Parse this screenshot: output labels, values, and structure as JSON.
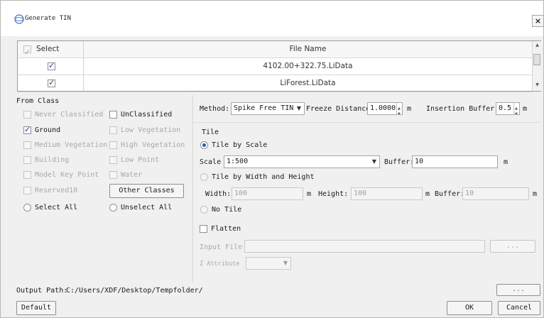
{
  "window": {
    "title": "Generate TIN",
    "close_label": "×"
  },
  "grid": {
    "header_select": "Select",
    "header_file": "File Name",
    "rows": [
      {
        "checked": true,
        "file": "4102.00+322.75.LiData"
      },
      {
        "checked": true,
        "file": "LiForest.LiData"
      }
    ]
  },
  "from_class": {
    "label": "From Class",
    "classes": [
      {
        "label": "Never Classified",
        "checked": false,
        "enabled": false
      },
      {
        "label": "UnClassified",
        "checked": false,
        "enabled": true
      },
      {
        "label": "Ground",
        "checked": true,
        "enabled": true
      },
      {
        "label": "Low Vegetation",
        "checked": false,
        "enabled": false
      },
      {
        "label": "Medium Vegetation",
        "checked": false,
        "enabled": false
      },
      {
        "label": "High Vegetation",
        "checked": false,
        "enabled": false
      },
      {
        "label": "Building",
        "checked": false,
        "enabled": false
      },
      {
        "label": "Low Point",
        "checked": false,
        "enabled": false
      },
      {
        "label": "Model Key Point",
        "checked": false,
        "enabled": false
      },
      {
        "label": "Water",
        "checked": false,
        "enabled": false
      },
      {
        "label": "Reserved10",
        "checked": false,
        "enabled": false
      }
    ],
    "other_classes_button": "Other Classes",
    "select_all": "Select All",
    "unselect_all": "Unselect All"
  },
  "method": {
    "label": "Method:",
    "value": "Spike Free TIN",
    "freeze_distance_label": "Freeze Distance",
    "freeze_distance_value": "1.0000",
    "freeze_distance_unit": "m",
    "insertion_buffer_label": "Insertion Buffer",
    "insertion_buffer_value": "0.5",
    "insertion_buffer_unit": "m"
  },
  "tile": {
    "label": "Tile",
    "by_scale_label": "Tile by Scale",
    "scale_label": "Scale",
    "scale_value": "1:500",
    "buffer_label": "Buffer:",
    "buffer_value": "10",
    "buffer_unit": "m",
    "by_width_height_label": "Tile by Width and Height",
    "width_label": "Width:",
    "width_value": "100",
    "width_unit": "m",
    "height_label": "Height:",
    "height_value": "100",
    "height_unit": "m",
    "wh_buffer_label": "Buffer:",
    "wh_buffer_value": "10",
    "wh_buffer_unit": "m",
    "no_tile_label": "No Tile",
    "selected": "by_scale"
  },
  "flatten": {
    "label": "Flatten",
    "input_file_label": "Input File",
    "input_file_value": "",
    "browse_label": "...",
    "z_attribute_label": "Z Attribute",
    "z_attribute_value": ""
  },
  "output": {
    "label": "Output Path:",
    "value": "C:/Users/XDF/Desktop/Tempfolder/",
    "browse_label": "..."
  },
  "footer": {
    "default_label": "Default",
    "ok_label": "OK",
    "cancel_label": "Cancel"
  },
  "colors": {
    "accent": "#2b55b8",
    "check": "#1f3f8a",
    "border": "#a6a6a6",
    "background": "#f0f0f0"
  }
}
